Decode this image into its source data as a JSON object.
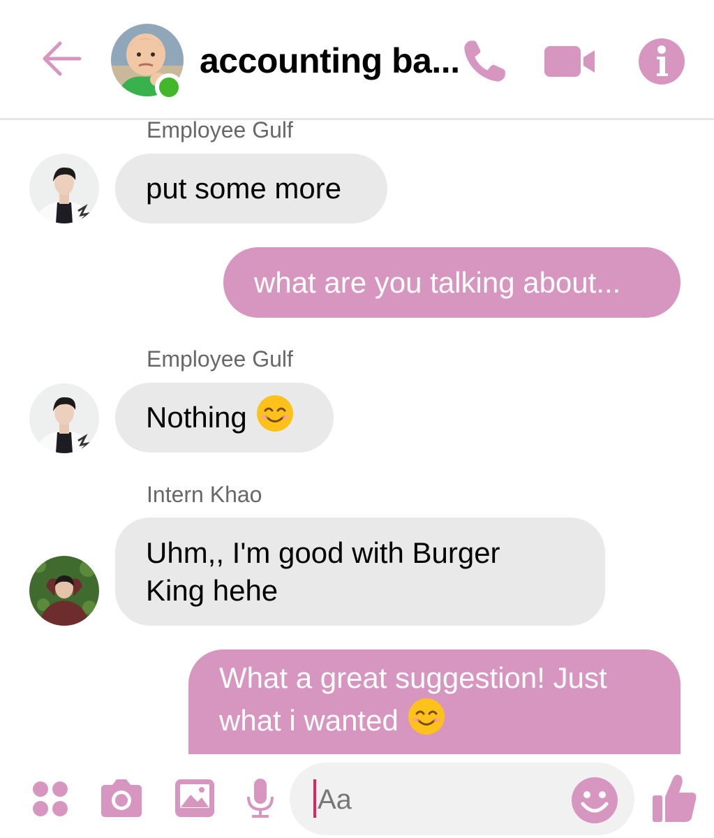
{
  "colors": {
    "accent": "#d696bf",
    "incoming_bubble": "#e9e9e9",
    "online": "#42b72a"
  },
  "header": {
    "title": "accounting ba...",
    "back_icon": "back-arrow-icon",
    "call_icon": "phone-icon",
    "video_icon": "video-camera-icon",
    "info_icon": "info-icon"
  },
  "messages": [
    {
      "sender": "Employee Gulf",
      "text": "put some more",
      "direction": "incoming"
    },
    {
      "text": "what are you talking about...",
      "direction": "outgoing"
    },
    {
      "sender": "Employee Gulf",
      "text": "Nothing",
      "emoji": "smiling-face-emoji",
      "direction": "incoming"
    },
    {
      "sender": "Intern Khao",
      "line1": "Uhm,, I'm good with Burger",
      "line2": "King hehe",
      "direction": "incoming"
    },
    {
      "line1": "What a great suggestion! Just",
      "line2": "what i wanted",
      "emoji": "smiling-face-emoji",
      "direction": "outgoing"
    }
  ],
  "composer": {
    "placeholder": "Aa",
    "icons": [
      "apps-icon",
      "camera-icon",
      "image-icon",
      "microphone-icon",
      "emoji-icon",
      "thumbs-up-icon"
    ]
  }
}
